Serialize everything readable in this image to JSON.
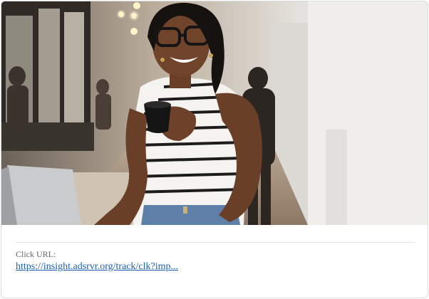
{
  "ad": {
    "image_subject": "woman-with-coffee-cup-and-laptop",
    "click_url_label": "Click URL:",
    "click_url_text": "https://insight.adsrvr.org/track/clk?imp..."
  },
  "colors": {
    "link": "#1a5fb4",
    "label": "#666666",
    "border": "#dcdcdc"
  }
}
